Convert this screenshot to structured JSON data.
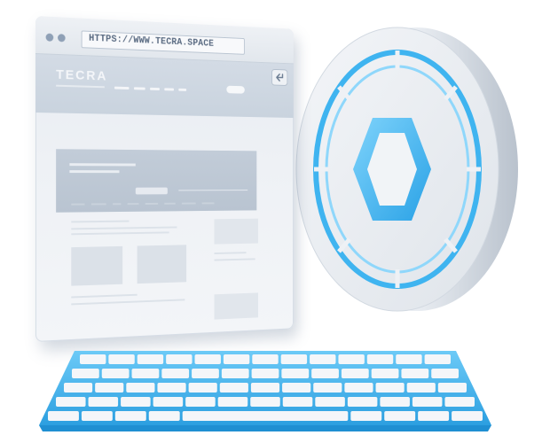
{
  "browser": {
    "url": "HTTPS://WWW.TECRA.SPACE",
    "logo": "TECRA"
  },
  "colors": {
    "accent": "#3fb4f0",
    "frame": "#e6ebf1",
    "placeholder": "#c9d3de"
  },
  "icons": {
    "reload": "return-arrow-icon",
    "coin": "hexagon-icon"
  }
}
